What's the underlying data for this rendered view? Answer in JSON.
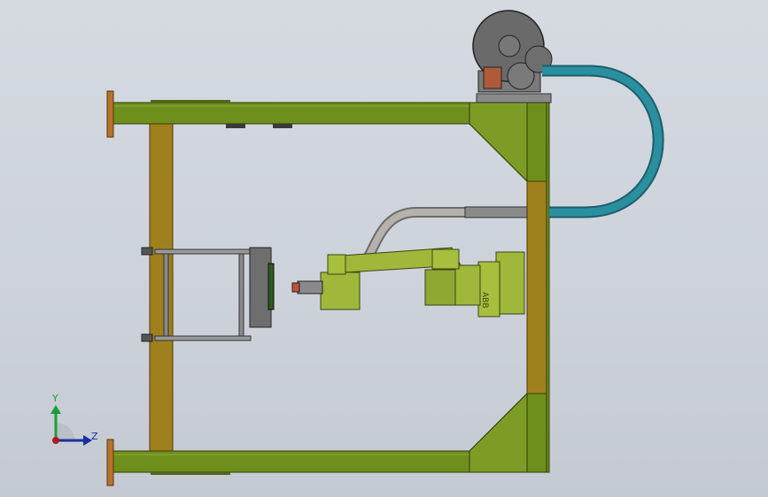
{
  "view": {
    "background_top": "#d5dae1",
    "background_bottom": "#c4c9d2"
  },
  "colors": {
    "frame_green": "#6f8f1c",
    "frame_green_dark": "#4a6312",
    "post_ochre": "#a0801c",
    "post_ochre_dark": "#6b5410",
    "end_plate": "#b5732a",
    "robot_green": "#9fb73a",
    "robot_green_dark": "#6d7f22",
    "hose_teal": "#2a7f8f",
    "hose_gray": "#9c9a98",
    "positioner_gray": "#5f5f5f",
    "triad_green": "#1a9f3a",
    "triad_blue": "#1a2f9f",
    "triad_red": "#b01a1a"
  },
  "triad": {
    "y_label": "Y",
    "z_label": "Z",
    "icon": "coordinate-triad-icon"
  },
  "robot": {
    "base_marking": "ABB"
  }
}
